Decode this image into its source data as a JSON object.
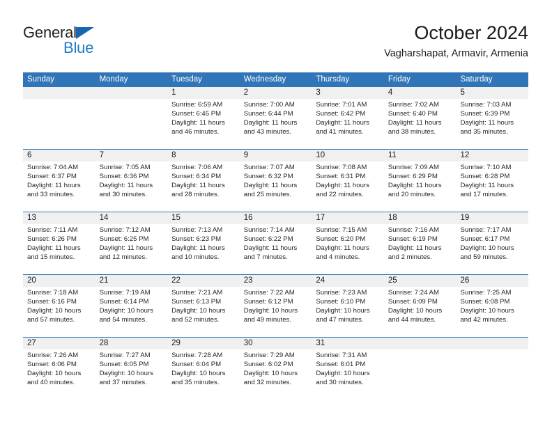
{
  "brand": {
    "name_part1": "General",
    "name_part2": "Blue",
    "triangle_color": "#1666b0",
    "blue_color": "#1f7ac4"
  },
  "header": {
    "title": "October 2024",
    "subtitle": "Vagharshapat, Armavir, Armenia"
  },
  "theme": {
    "header_blue": "#3075b8",
    "date_band_gray": "#f0f0f0",
    "text_color": "#262626"
  },
  "weekdays": [
    "Sunday",
    "Monday",
    "Tuesday",
    "Wednesday",
    "Thursday",
    "Friday",
    "Saturday"
  ],
  "weeks": [
    [
      {
        "day": "",
        "sunrise": "",
        "sunset": "",
        "daylight_line1": "",
        "daylight_line2": ""
      },
      {
        "day": "",
        "sunrise": "",
        "sunset": "",
        "daylight_line1": "",
        "daylight_line2": ""
      },
      {
        "day": "1",
        "sunrise": "Sunrise: 6:59 AM",
        "sunset": "Sunset: 6:45 PM",
        "daylight_line1": "Daylight: 11 hours",
        "daylight_line2": "and 46 minutes."
      },
      {
        "day": "2",
        "sunrise": "Sunrise: 7:00 AM",
        "sunset": "Sunset: 6:44 PM",
        "daylight_line1": "Daylight: 11 hours",
        "daylight_line2": "and 43 minutes."
      },
      {
        "day": "3",
        "sunrise": "Sunrise: 7:01 AM",
        "sunset": "Sunset: 6:42 PM",
        "daylight_line1": "Daylight: 11 hours",
        "daylight_line2": "and 41 minutes."
      },
      {
        "day": "4",
        "sunrise": "Sunrise: 7:02 AM",
        "sunset": "Sunset: 6:40 PM",
        "daylight_line1": "Daylight: 11 hours",
        "daylight_line2": "and 38 minutes."
      },
      {
        "day": "5",
        "sunrise": "Sunrise: 7:03 AM",
        "sunset": "Sunset: 6:39 PM",
        "daylight_line1": "Daylight: 11 hours",
        "daylight_line2": "and 35 minutes."
      }
    ],
    [
      {
        "day": "6",
        "sunrise": "Sunrise: 7:04 AM",
        "sunset": "Sunset: 6:37 PM",
        "daylight_line1": "Daylight: 11 hours",
        "daylight_line2": "and 33 minutes."
      },
      {
        "day": "7",
        "sunrise": "Sunrise: 7:05 AM",
        "sunset": "Sunset: 6:36 PM",
        "daylight_line1": "Daylight: 11 hours",
        "daylight_line2": "and 30 minutes."
      },
      {
        "day": "8",
        "sunrise": "Sunrise: 7:06 AM",
        "sunset": "Sunset: 6:34 PM",
        "daylight_line1": "Daylight: 11 hours",
        "daylight_line2": "and 28 minutes."
      },
      {
        "day": "9",
        "sunrise": "Sunrise: 7:07 AM",
        "sunset": "Sunset: 6:32 PM",
        "daylight_line1": "Daylight: 11 hours",
        "daylight_line2": "and 25 minutes."
      },
      {
        "day": "10",
        "sunrise": "Sunrise: 7:08 AM",
        "sunset": "Sunset: 6:31 PM",
        "daylight_line1": "Daylight: 11 hours",
        "daylight_line2": "and 22 minutes."
      },
      {
        "day": "11",
        "sunrise": "Sunrise: 7:09 AM",
        "sunset": "Sunset: 6:29 PM",
        "daylight_line1": "Daylight: 11 hours",
        "daylight_line2": "and 20 minutes."
      },
      {
        "day": "12",
        "sunrise": "Sunrise: 7:10 AM",
        "sunset": "Sunset: 6:28 PM",
        "daylight_line1": "Daylight: 11 hours",
        "daylight_line2": "and 17 minutes."
      }
    ],
    [
      {
        "day": "13",
        "sunrise": "Sunrise: 7:11 AM",
        "sunset": "Sunset: 6:26 PM",
        "daylight_line1": "Daylight: 11 hours",
        "daylight_line2": "and 15 minutes."
      },
      {
        "day": "14",
        "sunrise": "Sunrise: 7:12 AM",
        "sunset": "Sunset: 6:25 PM",
        "daylight_line1": "Daylight: 11 hours",
        "daylight_line2": "and 12 minutes."
      },
      {
        "day": "15",
        "sunrise": "Sunrise: 7:13 AM",
        "sunset": "Sunset: 6:23 PM",
        "daylight_line1": "Daylight: 11 hours",
        "daylight_line2": "and 10 minutes."
      },
      {
        "day": "16",
        "sunrise": "Sunrise: 7:14 AM",
        "sunset": "Sunset: 6:22 PM",
        "daylight_line1": "Daylight: 11 hours",
        "daylight_line2": "and 7 minutes."
      },
      {
        "day": "17",
        "sunrise": "Sunrise: 7:15 AM",
        "sunset": "Sunset: 6:20 PM",
        "daylight_line1": "Daylight: 11 hours",
        "daylight_line2": "and 4 minutes."
      },
      {
        "day": "18",
        "sunrise": "Sunrise: 7:16 AM",
        "sunset": "Sunset: 6:19 PM",
        "daylight_line1": "Daylight: 11 hours",
        "daylight_line2": "and 2 minutes."
      },
      {
        "day": "19",
        "sunrise": "Sunrise: 7:17 AM",
        "sunset": "Sunset: 6:17 PM",
        "daylight_line1": "Daylight: 10 hours",
        "daylight_line2": "and 59 minutes."
      }
    ],
    [
      {
        "day": "20",
        "sunrise": "Sunrise: 7:18 AM",
        "sunset": "Sunset: 6:16 PM",
        "daylight_line1": "Daylight: 10 hours",
        "daylight_line2": "and 57 minutes."
      },
      {
        "day": "21",
        "sunrise": "Sunrise: 7:19 AM",
        "sunset": "Sunset: 6:14 PM",
        "daylight_line1": "Daylight: 10 hours",
        "daylight_line2": "and 54 minutes."
      },
      {
        "day": "22",
        "sunrise": "Sunrise: 7:21 AM",
        "sunset": "Sunset: 6:13 PM",
        "daylight_line1": "Daylight: 10 hours",
        "daylight_line2": "and 52 minutes."
      },
      {
        "day": "23",
        "sunrise": "Sunrise: 7:22 AM",
        "sunset": "Sunset: 6:12 PM",
        "daylight_line1": "Daylight: 10 hours",
        "daylight_line2": "and 49 minutes."
      },
      {
        "day": "24",
        "sunrise": "Sunrise: 7:23 AM",
        "sunset": "Sunset: 6:10 PM",
        "daylight_line1": "Daylight: 10 hours",
        "daylight_line2": "and 47 minutes."
      },
      {
        "day": "25",
        "sunrise": "Sunrise: 7:24 AM",
        "sunset": "Sunset: 6:09 PM",
        "daylight_line1": "Daylight: 10 hours",
        "daylight_line2": "and 44 minutes."
      },
      {
        "day": "26",
        "sunrise": "Sunrise: 7:25 AM",
        "sunset": "Sunset: 6:08 PM",
        "daylight_line1": "Daylight: 10 hours",
        "daylight_line2": "and 42 minutes."
      }
    ],
    [
      {
        "day": "27",
        "sunrise": "Sunrise: 7:26 AM",
        "sunset": "Sunset: 6:06 PM",
        "daylight_line1": "Daylight: 10 hours",
        "daylight_line2": "and 40 minutes."
      },
      {
        "day": "28",
        "sunrise": "Sunrise: 7:27 AM",
        "sunset": "Sunset: 6:05 PM",
        "daylight_line1": "Daylight: 10 hours",
        "daylight_line2": "and 37 minutes."
      },
      {
        "day": "29",
        "sunrise": "Sunrise: 7:28 AM",
        "sunset": "Sunset: 6:04 PM",
        "daylight_line1": "Daylight: 10 hours",
        "daylight_line2": "and 35 minutes."
      },
      {
        "day": "30",
        "sunrise": "Sunrise: 7:29 AM",
        "sunset": "Sunset: 6:02 PM",
        "daylight_line1": "Daylight: 10 hours",
        "daylight_line2": "and 32 minutes."
      },
      {
        "day": "31",
        "sunrise": "Sunrise: 7:31 AM",
        "sunset": "Sunset: 6:01 PM",
        "daylight_line1": "Daylight: 10 hours",
        "daylight_line2": "and 30 minutes."
      },
      {
        "day": "",
        "sunrise": "",
        "sunset": "",
        "daylight_line1": "",
        "daylight_line2": ""
      },
      {
        "day": "",
        "sunrise": "",
        "sunset": "",
        "daylight_line1": "",
        "daylight_line2": ""
      }
    ]
  ]
}
